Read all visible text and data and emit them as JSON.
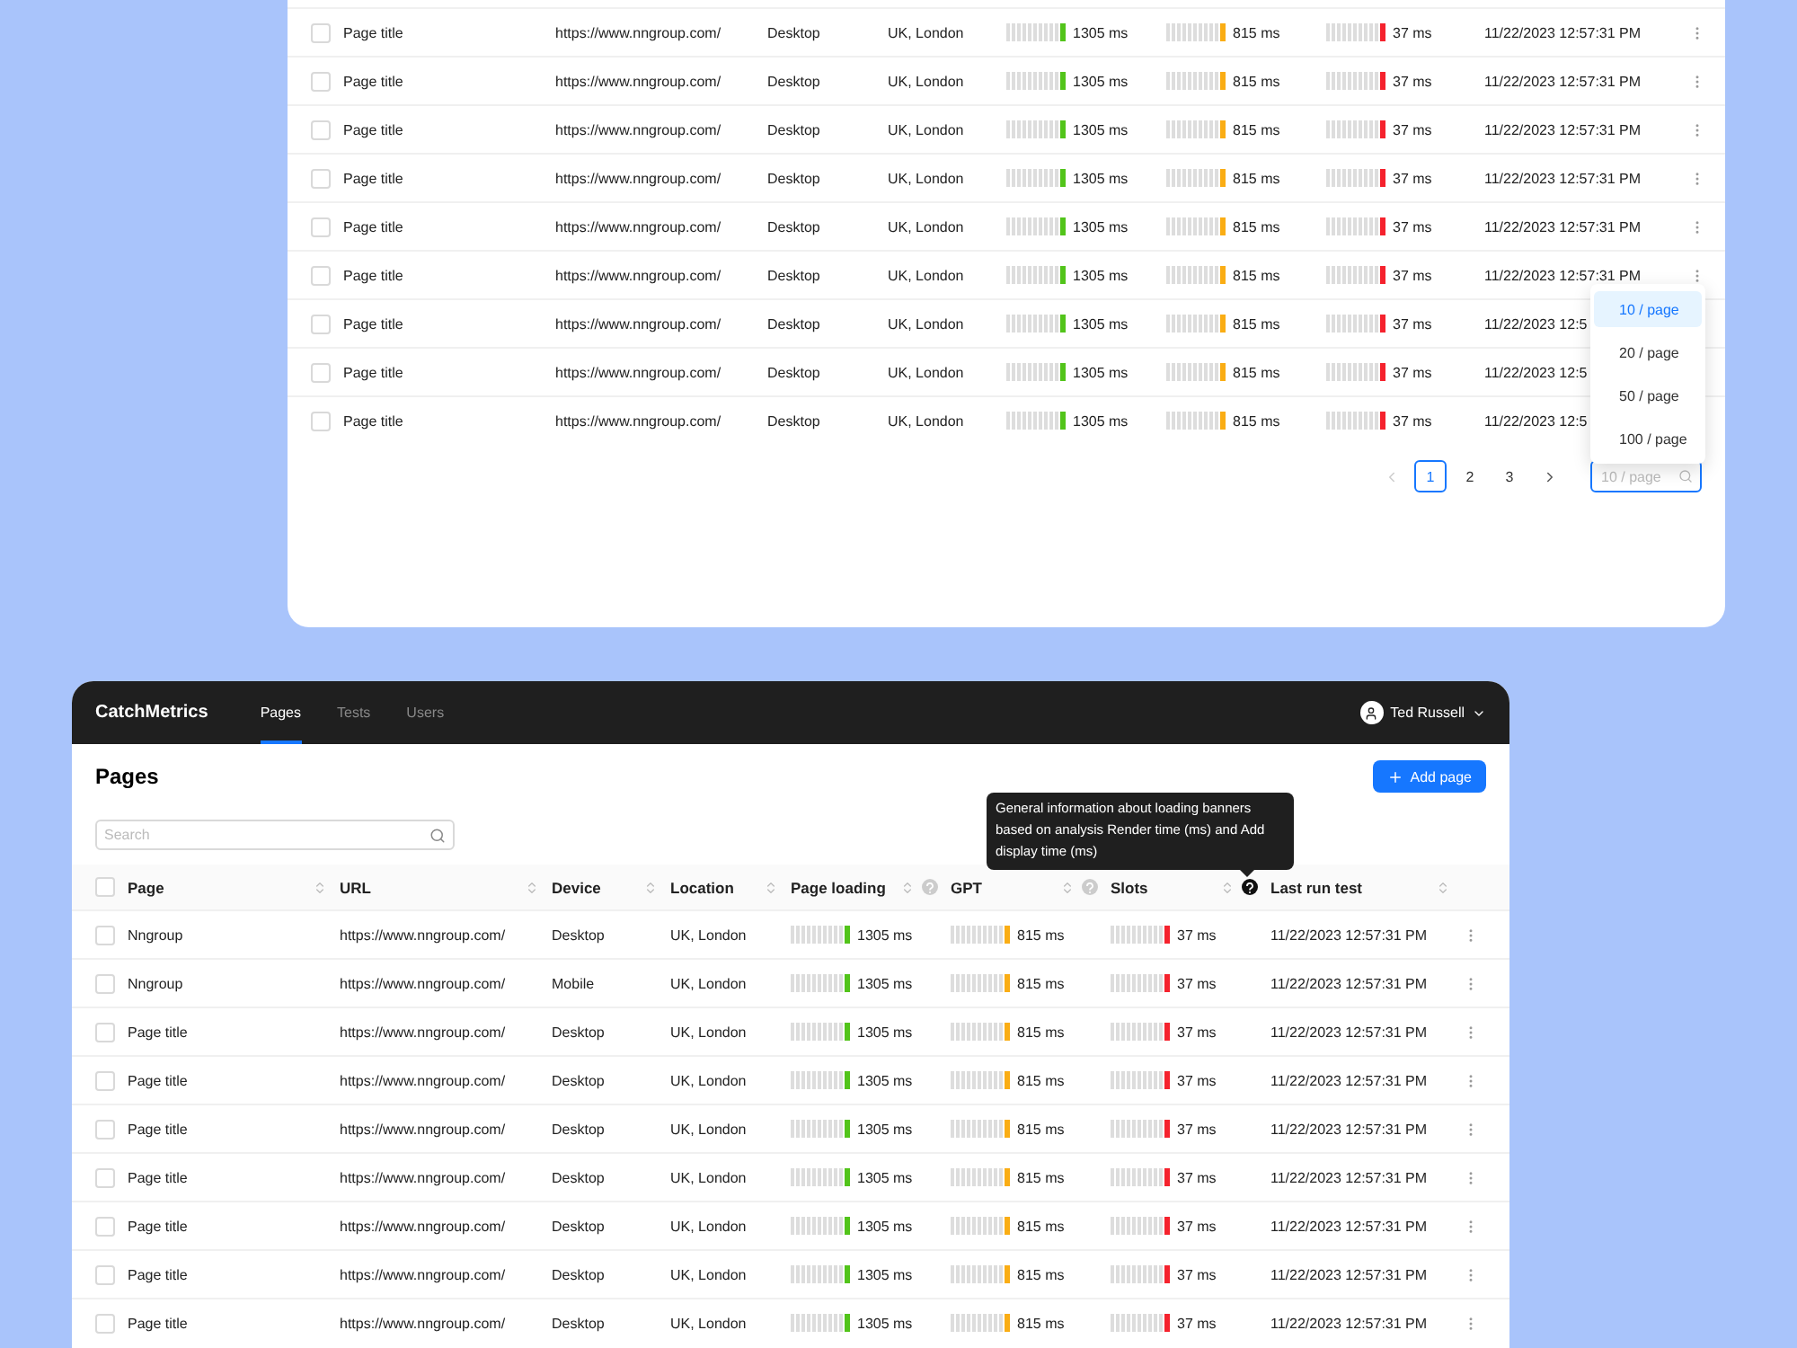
{
  "top_table": {
    "rows": [
      {
        "checked": false,
        "page": "Page title",
        "url": "https://www.nngroup.com/",
        "device": "Desktop",
        "location": "UK, London",
        "metrics": [
          {
            "reading": "1305 ms",
            "color": "#52c41a"
          },
          {
            "reading": "815 ms",
            "color": "#faad14"
          },
          {
            "reading": "37 ms",
            "color": "#f5222d"
          }
        ],
        "last_run": "11/22/2023 12:57:31 PM"
      },
      {
        "checked": false,
        "page": "Page title",
        "url": "https://www.nngroup.com/",
        "device": "Desktop",
        "location": "UK, London",
        "metrics": [
          {
            "reading": "1305 ms",
            "color": "#52c41a"
          },
          {
            "reading": "815 ms",
            "color": "#faad14"
          },
          {
            "reading": "37 ms",
            "color": "#f5222d"
          }
        ],
        "last_run": "11/22/2023 12:57:31 PM"
      },
      {
        "checked": false,
        "page": "Page title",
        "url": "https://www.nngroup.com/",
        "device": "Desktop",
        "location": "UK, London",
        "metrics": [
          {
            "reading": "1305 ms",
            "color": "#52c41a"
          },
          {
            "reading": "815 ms",
            "color": "#faad14"
          },
          {
            "reading": "37 ms",
            "color": "#f5222d"
          }
        ],
        "last_run": "11/22/2023 12:57:31 PM"
      },
      {
        "checked": false,
        "page": "Page title",
        "url": "https://www.nngroup.com/",
        "device": "Desktop",
        "location": "UK, London",
        "metrics": [
          {
            "reading": "1305 ms",
            "color": "#52c41a"
          },
          {
            "reading": "815 ms",
            "color": "#faad14"
          },
          {
            "reading": "37 ms",
            "color": "#f5222d"
          }
        ],
        "last_run": "11/22/2023 12:57:31 PM"
      },
      {
        "checked": false,
        "page": "Page title",
        "url": "https://www.nngroup.com/",
        "device": "Desktop",
        "location": "UK, London",
        "metrics": [
          {
            "reading": "1305 ms",
            "color": "#52c41a"
          },
          {
            "reading": "815 ms",
            "color": "#faad14"
          },
          {
            "reading": "37 ms",
            "color": "#f5222d"
          }
        ],
        "last_run": "11/22/2023 12:57:31 PM"
      },
      {
        "checked": false,
        "page": "Page title",
        "url": "https://www.nngroup.com/",
        "device": "Desktop",
        "location": "UK, London",
        "metrics": [
          {
            "reading": "1305 ms",
            "color": "#52c41a"
          },
          {
            "reading": "815 ms",
            "color": "#faad14"
          },
          {
            "reading": "37 ms",
            "color": "#f5222d"
          }
        ],
        "last_run": "11/22/2023 12:57:31 PM"
      },
      {
        "checked": false,
        "page": "Page title",
        "url": "https://www.nngroup.com/",
        "device": "Desktop",
        "location": "UK, London",
        "metrics": [
          {
            "reading": "1305 ms",
            "color": "#52c41a"
          },
          {
            "reading": "815 ms",
            "color": "#faad14"
          },
          {
            "reading": "37 ms",
            "color": "#f5222d"
          }
        ],
        "last_run": "11/22/2023 12:5",
        "more_button": false
      },
      {
        "checked": false,
        "page": "Page title",
        "url": "https://www.nngroup.com/",
        "device": "Desktop",
        "location": "UK, London",
        "metrics": [
          {
            "reading": "1305 ms",
            "color": "#52c41a"
          },
          {
            "reading": "815 ms",
            "color": "#faad14"
          },
          {
            "reading": "37 ms",
            "color": "#f5222d"
          }
        ],
        "last_run": "11/22/2023 12:5",
        "more_button": false
      },
      {
        "checked": false,
        "page": "Page title",
        "url": "https://www.nngroup.com/",
        "device": "Desktop",
        "location": "UK, London",
        "metrics": [
          {
            "reading": "1305 ms",
            "color": "#52c41a"
          },
          {
            "reading": "815 ms",
            "color": "#faad14"
          },
          {
            "reading": "37 ms",
            "color": "#f5222d"
          }
        ],
        "last_run": "11/22/2023 12:5",
        "more_button": false
      }
    ],
    "pagination": {
      "pages": [
        {
          "label": "1",
          "selected": true
        },
        {
          "label": "2",
          "selected": false
        },
        {
          "label": "3",
          "selected": false
        }
      ],
      "page_size": {
        "placeholder": "10 / page"
      }
    },
    "page_size_menu": [
      {
        "label": "10 / page",
        "selected": true
      },
      {
        "label": "20 / page",
        "selected": false
      },
      {
        "label": "50 / page",
        "selected": false
      },
      {
        "label": "100 / page",
        "selected": false
      }
    ]
  },
  "app": {
    "brand": "CatchMetrics",
    "nav": [
      {
        "label": "Pages",
        "selected": true
      },
      {
        "label": "Tests",
        "selected": false
      },
      {
        "label": "Users",
        "selected": false
      }
    ],
    "user": "Ted Russell",
    "title": "Pages",
    "add_button": "Add page",
    "search": {
      "placeholder": "Search"
    },
    "select_all": {
      "checked": false
    },
    "columns": [
      {
        "label": "Page",
        "kind": "plain"
      },
      {
        "label": "URL",
        "kind": "plain"
      },
      {
        "label": "Device",
        "kind": "plain"
      },
      {
        "label": "Location",
        "kind": "plain"
      },
      {
        "label": "Page loading",
        "kind": "info"
      },
      {
        "label": "GPT",
        "kind": "info"
      },
      {
        "label": "Slots",
        "kind": "active"
      },
      {
        "label": "Last run test",
        "kind": "plain"
      }
    ],
    "tooltip": "General information about loading banners based on analysis Render time (ms) and Add display time (ms)",
    "rows": [
      {
        "checked": false,
        "page": "Nngroup",
        "url": "https://www.nngroup.com/",
        "device": "Desktop",
        "location": "UK, London",
        "metrics": [
          {
            "reading": "1305 ms",
            "color": "#52c41a"
          },
          {
            "reading": "815 ms",
            "color": "#faad14"
          },
          {
            "reading": "37 ms",
            "color": "#f5222d"
          }
        ],
        "last_run": "11/22/2023 12:57:31 PM"
      },
      {
        "checked": false,
        "page": "Nngroup",
        "url": "https://www.nngroup.com/",
        "device": "Mobile",
        "location": "UK, London",
        "metrics": [
          {
            "reading": "1305 ms",
            "color": "#52c41a"
          },
          {
            "reading": "815 ms",
            "color": "#faad14"
          },
          {
            "reading": "37 ms",
            "color": "#f5222d"
          }
        ],
        "last_run": "11/22/2023 12:57:31 PM"
      },
      {
        "checked": false,
        "page": "Page title",
        "url": "https://www.nngroup.com/",
        "device": "Desktop",
        "location": "UK, London",
        "metrics": [
          {
            "reading": "1305 ms",
            "color": "#52c41a"
          },
          {
            "reading": "815 ms",
            "color": "#faad14"
          },
          {
            "reading": "37 ms",
            "color": "#f5222d"
          }
        ],
        "last_run": "11/22/2023 12:57:31 PM"
      },
      {
        "checked": false,
        "page": "Page title",
        "url": "https://www.nngroup.com/",
        "device": "Desktop",
        "location": "UK, London",
        "metrics": [
          {
            "reading": "1305 ms",
            "color": "#52c41a"
          },
          {
            "reading": "815 ms",
            "color": "#faad14"
          },
          {
            "reading": "37 ms",
            "color": "#f5222d"
          }
        ],
        "last_run": "11/22/2023 12:57:31 PM"
      },
      {
        "checked": false,
        "page": "Page title",
        "url": "https://www.nngroup.com/",
        "device": "Desktop",
        "location": "UK, London",
        "metrics": [
          {
            "reading": "1305 ms",
            "color": "#52c41a"
          },
          {
            "reading": "815 ms",
            "color": "#faad14"
          },
          {
            "reading": "37 ms",
            "color": "#f5222d"
          }
        ],
        "last_run": "11/22/2023 12:57:31 PM"
      },
      {
        "checked": false,
        "page": "Page title",
        "url": "https://www.nngroup.com/",
        "device": "Desktop",
        "location": "UK, London",
        "metrics": [
          {
            "reading": "1305 ms",
            "color": "#52c41a"
          },
          {
            "reading": "815 ms",
            "color": "#faad14"
          },
          {
            "reading": "37 ms",
            "color": "#f5222d"
          }
        ],
        "last_run": "11/22/2023 12:57:31 PM"
      },
      {
        "checked": false,
        "page": "Page title",
        "url": "https://www.nngroup.com/",
        "device": "Desktop",
        "location": "UK, London",
        "metrics": [
          {
            "reading": "1305 ms",
            "color": "#52c41a"
          },
          {
            "reading": "815 ms",
            "color": "#faad14"
          },
          {
            "reading": "37 ms",
            "color": "#f5222d"
          }
        ],
        "last_run": "11/22/2023 12:57:31 PM"
      },
      {
        "checked": false,
        "page": "Page title",
        "url": "https://www.nngroup.com/",
        "device": "Desktop",
        "location": "UK, London",
        "metrics": [
          {
            "reading": "1305 ms",
            "color": "#52c41a"
          },
          {
            "reading": "815 ms",
            "color": "#faad14"
          },
          {
            "reading": "37 ms",
            "color": "#f5222d"
          }
        ],
        "last_run": "11/22/2023 12:57:31 PM"
      },
      {
        "checked": false,
        "page": "Page title",
        "url": "https://www.nngroup.com/",
        "device": "Desktop",
        "location": "UK, London",
        "metrics": [
          {
            "reading": "1305 ms",
            "color": "#52c41a"
          },
          {
            "reading": "815 ms",
            "color": "#faad14"
          },
          {
            "reading": "37 ms",
            "color": "#f5222d"
          }
        ],
        "last_run": "11/22/2023 12:57:31 PM"
      }
    ]
  }
}
